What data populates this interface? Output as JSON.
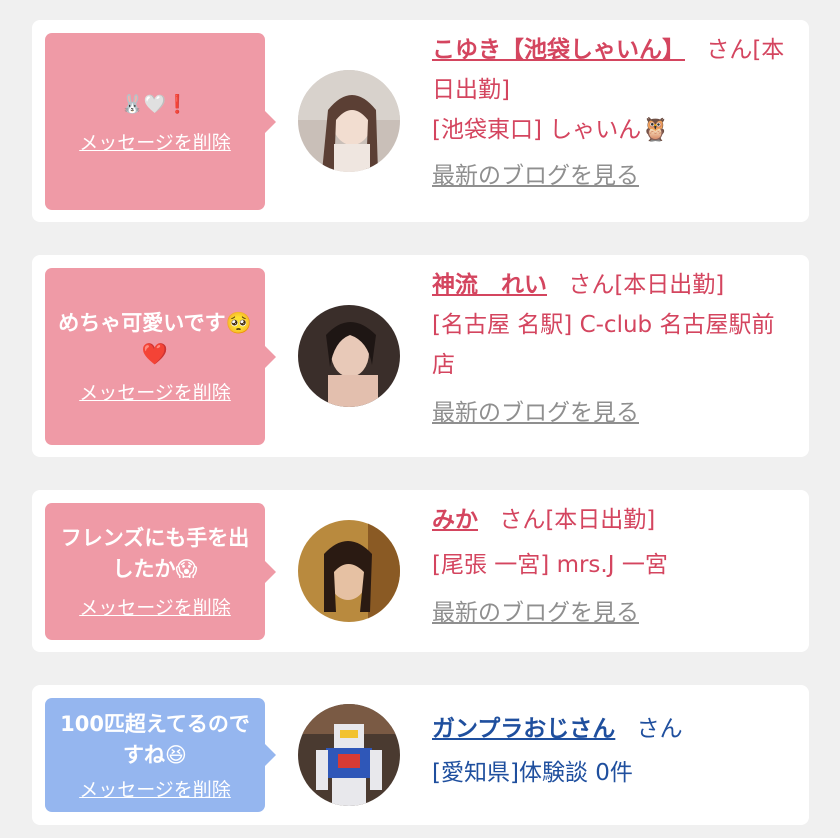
{
  "items": [
    {
      "message": "🐰🤍❗",
      "delete_label": "メッセージを削除",
      "name": "こゆき【池袋しゃいん】",
      "suffix": "さん[本日出勤]",
      "location": "[池袋東口] しゃいん🦉",
      "blog_label": "最新のブログを見る"
    },
    {
      "message": "めちゃ可愛いです🥺❤️",
      "delete_label": "メッセージを削除",
      "name": "神流　れい",
      "suffix": "さん[本日出勤]",
      "location": "[名古屋 名駅] C-club 名古屋駅前店",
      "blog_label": "最新のブログを見る"
    },
    {
      "message": "フレンズにも手を出したか😱",
      "delete_label": "メッセージを削除",
      "name": "みか",
      "suffix": "さん[本日出勤]",
      "location": "[尾張 一宮] mrs.J 一宮",
      "blog_label": "最新のブログを見る"
    },
    {
      "message": "100匹超えてるのですね😆",
      "delete_label": "メッセージを削除",
      "name": "ガンプラおじさん",
      "suffix": "さん",
      "location": "[愛知県]体験談 0件"
    }
  ],
  "colors": {
    "pink_bubble": "#ef9aa6",
    "blue_bubble": "#95b6ef",
    "pink_text": "#d4455f",
    "blue_text": "#1f4f9e",
    "link_gray": "#8f8f8f"
  }
}
